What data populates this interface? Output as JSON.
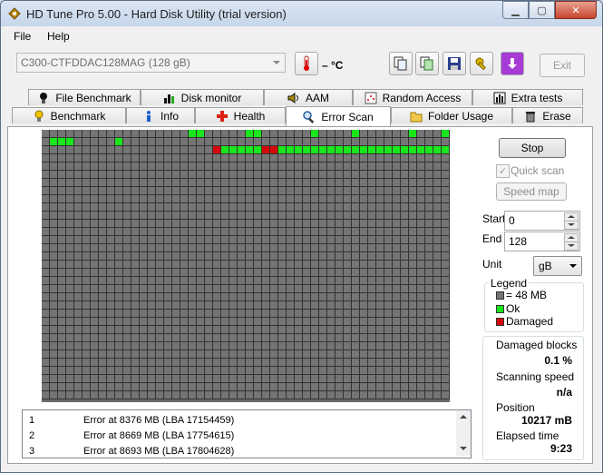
{
  "window": {
    "title": "HD Tune Pro 5.00 - Hard Disk Utility (trial version)"
  },
  "menu": {
    "file": "File",
    "help": "Help"
  },
  "toolbar": {
    "drive": "C300-CTFDDAC128MAG (128 gB)",
    "temperature": "– °C",
    "exit_label": "Exit"
  },
  "tabs_top": [
    "File Benchmark",
    "Disk monitor",
    "AAM",
    "Random Access",
    "Extra tests"
  ],
  "tabs_bottom": [
    "Benchmark",
    "Info",
    "Health",
    "Error Scan",
    "Folder Usage",
    "Erase"
  ],
  "active_tab": "Error Scan",
  "controls": {
    "stop_label": "Stop",
    "quick_scan_label": "Quick scan",
    "quick_scan_checked": true,
    "speed_map_label": "Speed map",
    "start_label": "Start",
    "start_value": "0",
    "end_label": "End",
    "end_value": "128",
    "unit_label": "Unit",
    "unit_value": "gB"
  },
  "legend": {
    "title": "Legend",
    "block": "= 48 MB",
    "ok": "Ok",
    "damaged": "Damaged",
    "colors": {
      "block": "#757575",
      "ok": "#19e61b",
      "damaged": "#d40a0a"
    }
  },
  "stats": {
    "damaged_blocks_label": "Damaged blocks",
    "damaged_blocks_value": "0.1 %",
    "scanning_speed_label": "Scanning speed",
    "scanning_speed_value": "n/a",
    "position_label": "Position",
    "position_value": "10217 mB",
    "elapsed_label": "Elapsed time",
    "elapsed_value": "9:23"
  },
  "errors": [
    {
      "n": "1",
      "text": "Error at 8376 MB (LBA 17154459)"
    },
    {
      "n": "2",
      "text": "Error at 8669 MB (LBA 17754615)"
    },
    {
      "n": "3",
      "text": "Error at 8693 MB (LBA 17804628)"
    }
  ]
}
